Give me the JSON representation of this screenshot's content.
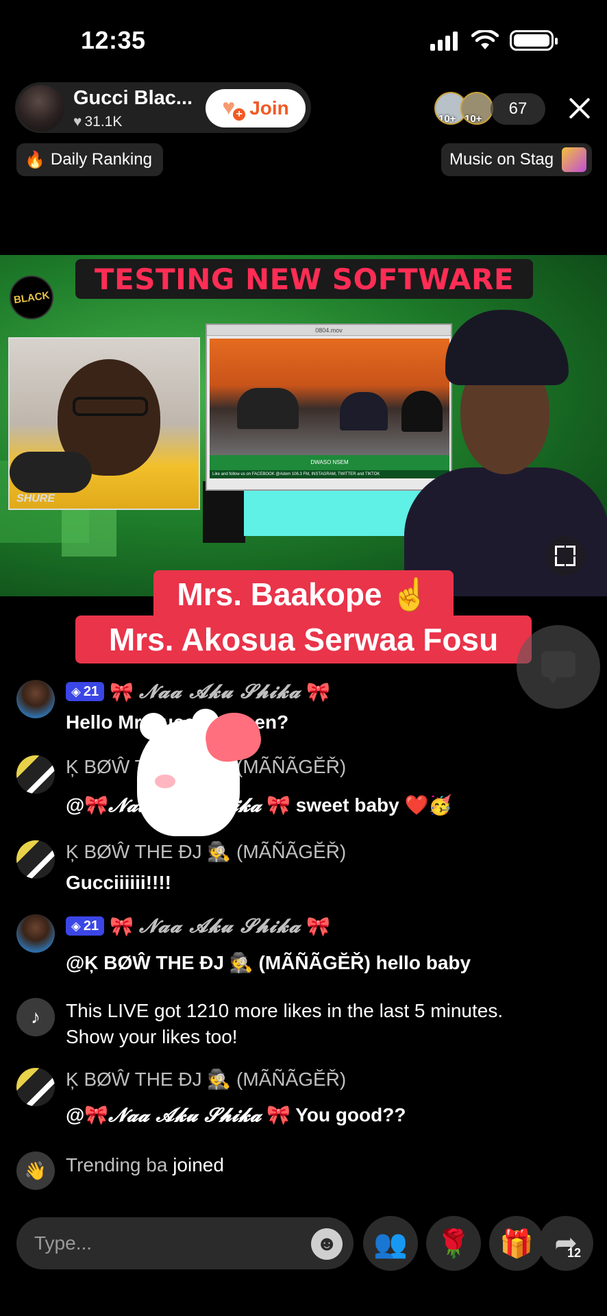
{
  "status": {
    "time": "12:35"
  },
  "host": {
    "name": "Gucci Blac...",
    "likes": "31.1K",
    "join_label": "Join"
  },
  "viewers": {
    "badges": [
      "10+",
      "10+"
    ],
    "count": "67"
  },
  "top_pills": {
    "daily_ranking": "Daily Ranking",
    "music_stage": "Music on Stag"
  },
  "video": {
    "banner": "TESTING NEW SOFTWARE",
    "logo": "BLACK",
    "mic_brand": "SHURE",
    "window_title": "0804.mov",
    "lower_third": "DWASO NSEM",
    "ticker": "Like and follow us on FACEBOOK @Adom 106.3 FM, INSTAGRAM, TWITTER and TIKTOK"
  },
  "captions": {
    "line1": "Mrs. Baakope ☝️",
    "line2": "Mrs. Akosua Serwaa Fosu"
  },
  "chat": [
    {
      "type": "user",
      "avatar": "woman",
      "level": "21",
      "name_prefix": "🎀",
      "name": "𝓝𝓪𝓪 𝓐𝓴𝓾 𝓢𝓱𝓲𝓴𝓪",
      "name_suffix": "🎀",
      "message": "Hello Mr Gucci, ete sen?"
    },
    {
      "type": "user",
      "avatar": "dj",
      "name": "Ķ BØŴ THE ĐJ 🕵️ (MÃÑÃGĔŘ)",
      "message_prefix": "@🎀",
      "message_fancy": "𝓝𝓪𝓪 𝓐𝓴𝓾 𝓢𝓱𝓲𝓴𝓪",
      "message": "🎀 sweet baby ❤️🥳"
    },
    {
      "type": "user",
      "avatar": "dj",
      "name": "Ķ BØŴ THE ĐJ 🕵️ (MÃÑÃGĔŘ)",
      "message": "Gucciiiiii!!!!"
    },
    {
      "type": "user",
      "avatar": "woman",
      "level": "21",
      "name_prefix": "🎀",
      "name": "𝓝𝓪𝓪 𝓐𝓴𝓾 𝓢𝓱𝓲𝓴𝓪",
      "name_suffix": "🎀",
      "message": "@Ķ BØŴ THE ĐJ 🕵️ (MÃÑÃGĔŘ) hello baby"
    },
    {
      "type": "system",
      "line1": "This LIVE got 1210 more likes in the last 5 minutes.",
      "line2": "Show your likes too!"
    },
    {
      "type": "user",
      "avatar": "dj",
      "name": "Ķ BØŴ THE ĐJ 🕵️ (MÃÑÃGĔŘ)",
      "message_prefix": "@🎀",
      "message_fancy": "𝓝𝓪𝓪 𝓐𝓴𝓾 𝓢𝓱𝓲𝓴𝓪",
      "message": "🎀 You good??"
    },
    {
      "type": "joined",
      "name": "Trending ba",
      "action": "joined"
    }
  ],
  "input": {
    "placeholder": "Type..."
  },
  "actions": {
    "share_count": "12"
  }
}
